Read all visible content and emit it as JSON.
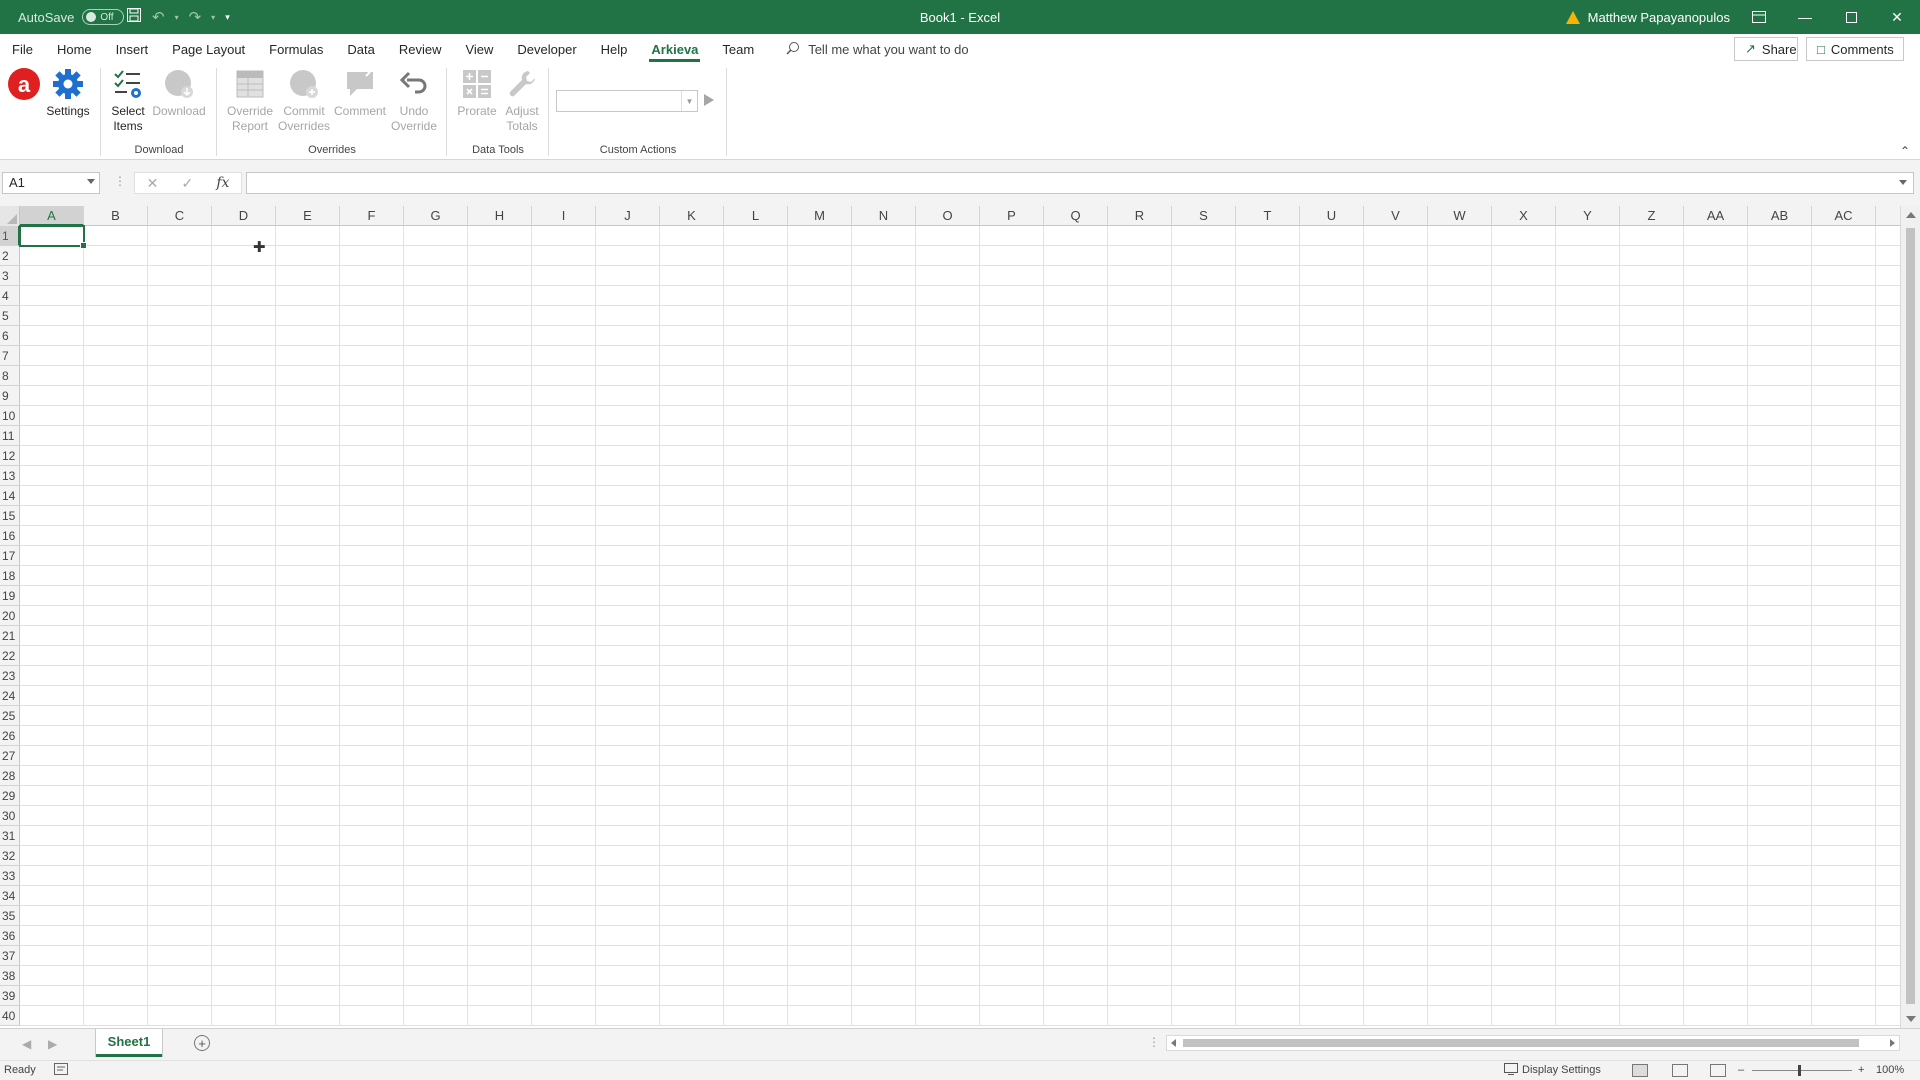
{
  "titlebar": {
    "autosave_label": "AutoSave",
    "autosave_state": "Off",
    "window_title": "Book1  -  Excel",
    "user_name": "Matthew Papayanopulos"
  },
  "tabs": [
    "File",
    "Home",
    "Insert",
    "Page Layout",
    "Formulas",
    "Data",
    "Review",
    "View",
    "Developer",
    "Help",
    "Arkieva",
    "Team"
  ],
  "active_tab": "Arkieva",
  "tell_me": "Tell me what you want to do",
  "share_label": "Share",
  "comments_label": "Comments",
  "ribbon": {
    "settings": "Settings",
    "select_items_1": "Select",
    "select_items_2": "Items",
    "download": "Download",
    "override_report_1": "Override",
    "override_report_2": "Report",
    "commit_overrides_1": "Commit",
    "commit_overrides_2": "Overrides",
    "comment": "Comment",
    "undo_override_1": "Undo",
    "undo_override_2": "Override",
    "prorate": "Prorate",
    "adjust_totals_1": "Adjust",
    "adjust_totals_2": "Totals",
    "groups": {
      "download": "Download",
      "overrides": "Overrides",
      "data_tools": "Data Tools",
      "custom_actions": "Custom Actions"
    },
    "logo_letter": "a"
  },
  "formula_bar": {
    "name_box": "A1",
    "fx": "fx",
    "value": ""
  },
  "grid": {
    "columns": [
      "A",
      "B",
      "C",
      "D",
      "E",
      "F",
      "G",
      "H",
      "I",
      "J",
      "K",
      "L",
      "M",
      "N",
      "O",
      "P",
      "Q",
      "R",
      "S",
      "T",
      "U",
      "V",
      "W",
      "X",
      "Y",
      "Z",
      "AA",
      "AB",
      "AC"
    ],
    "rows": [
      "1",
      "2",
      "3",
      "4",
      "5",
      "6",
      "7",
      "8",
      "9",
      "10",
      "11",
      "12",
      "13",
      "14",
      "15",
      "16",
      "17",
      "18",
      "19",
      "20",
      "21",
      "22",
      "23",
      "24",
      "25",
      "26",
      "27",
      "28",
      "29",
      "30",
      "31",
      "32",
      "33",
      "34",
      "35",
      "36",
      "37",
      "38",
      "39",
      "40"
    ],
    "selected_cell": "A1"
  },
  "sheets": [
    "Sheet1"
  ],
  "status": {
    "ready": "Ready",
    "display_settings": "Display Settings",
    "zoom": "100%"
  },
  "colors": {
    "accent": "#217346",
    "logo": "#e02020"
  }
}
